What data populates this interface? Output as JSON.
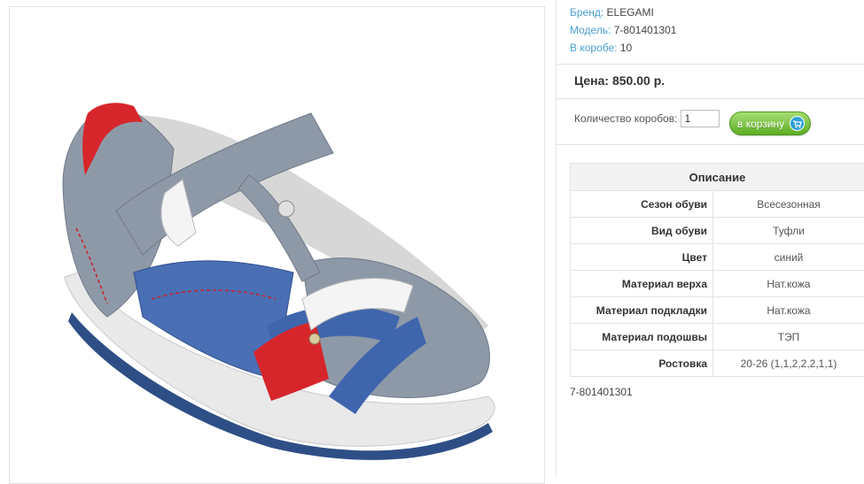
{
  "product": {
    "meta": [
      {
        "label": "Бренд:",
        "value": "ELEGAMI"
      },
      {
        "label": "Модель:",
        "value": "7-801401301"
      },
      {
        "label": "В коробе:",
        "value": "10"
      }
    ],
    "price": "Цена: 850.00 р.",
    "quantity": {
      "label": "Количество коробов:",
      "value": "1"
    },
    "cart_button": "в корзину",
    "sku_footer": "7-801401301"
  },
  "description": {
    "title": "Описание",
    "rows": [
      {
        "key": "Сезон обуви",
        "value": "Всесезонная"
      },
      {
        "key": "Вид обуви",
        "value": "Туфли"
      },
      {
        "key": "Цвет",
        "value": "синий"
      },
      {
        "key": "Материал верха",
        "value": "Нат.кожа"
      },
      {
        "key": "Материал подкладки",
        "value": "Нат.кожа"
      },
      {
        "key": "Материал подошвы",
        "value": "ТЭП"
      },
      {
        "key": "Ростовка",
        "value": "20-26 (1,1,2,2,2,1,1)"
      }
    ]
  },
  "colors": {
    "label_blue": "#4a9fd3",
    "button_green": "#5cae22",
    "cart_icon": "#2d9fd7"
  },
  "icons": {
    "cart": "cart-icon"
  }
}
